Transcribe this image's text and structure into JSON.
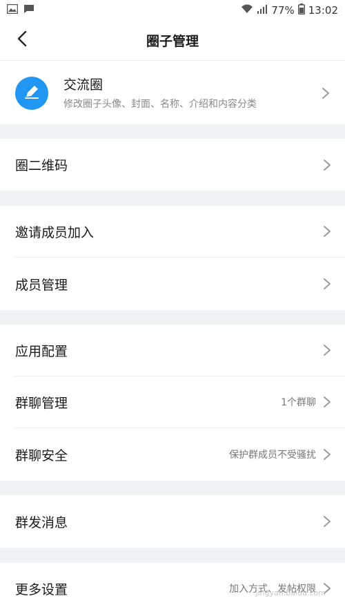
{
  "status_bar": {
    "battery": "77%",
    "time": "13:02"
  },
  "header": {
    "title": "圈子管理"
  },
  "circle": {
    "name": "交流圈",
    "description": "修改圈子头像、封面、名称、介绍和内容分类"
  },
  "menu": {
    "qrcode": "圈二维码",
    "invite": "邀请成员加入",
    "members": "成员管理",
    "app_config": "应用配置",
    "group_chat": "群聊管理",
    "group_chat_value": "1个群聊",
    "group_security": "群聊安全",
    "group_security_value": "保护群成员不受骚扰",
    "broadcast": "群发消息",
    "more_settings": "更多设置",
    "more_settings_value": "加入方式、发帖权限"
  },
  "watermark": {
    "text": "jingyan.baidu.com"
  },
  "colors": {
    "accent": "#2196f3",
    "gap": "#f1f2f4"
  }
}
